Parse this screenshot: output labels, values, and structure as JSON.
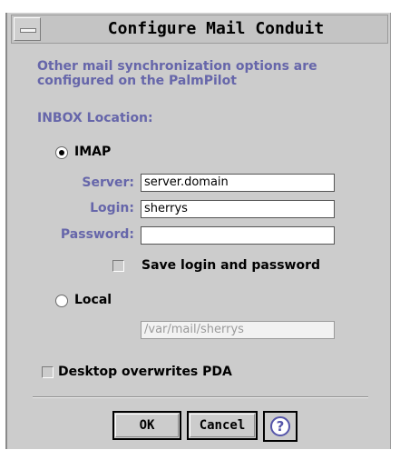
{
  "window": {
    "title": "Configure Mail Conduit"
  },
  "info_text": "Other mail synchronization options are configured on the PalmPilot",
  "inbox_section": {
    "label": "INBOX Location:"
  },
  "imap": {
    "label": "IMAP",
    "selected": true,
    "server": {
      "label": "Server:",
      "value": "server.domain"
    },
    "login": {
      "label": "Login:",
      "value": "sherrys"
    },
    "password": {
      "label": "Password:",
      "value": ""
    },
    "save_login": {
      "label": "Save login and password",
      "checked": false
    }
  },
  "local": {
    "label": "Local",
    "selected": false,
    "path": {
      "value": "/var/mail/sherrys",
      "disabled": true
    }
  },
  "desktop_overwrites": {
    "label": "Desktop overwrites PDA",
    "checked": false
  },
  "buttons": {
    "ok": "OK",
    "cancel": "Cancel",
    "help_icon": "help-question-icon"
  },
  "colors": {
    "label_accent": "#6666aa",
    "window_bg": "#cccccc"
  }
}
